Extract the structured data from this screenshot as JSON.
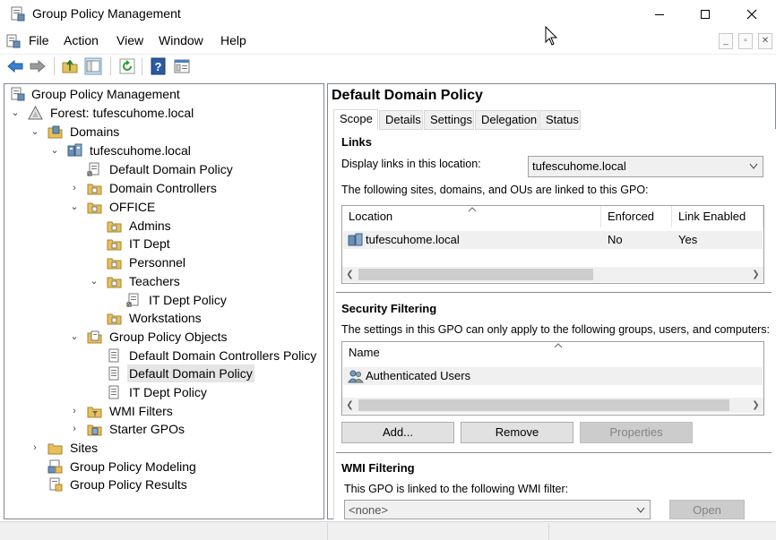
{
  "window": {
    "title": "Group Policy Management"
  },
  "menubar": {
    "items": [
      "File",
      "Action",
      "View",
      "Window",
      "Help"
    ]
  },
  "toolbar": {
    "icons": [
      "back-arrow-icon",
      "forward-arrow-icon",
      "up-folder-icon",
      "show-hide-tree-icon",
      "refresh-icon",
      "help-icon",
      "properties-icon"
    ]
  },
  "tree": {
    "root": "Group Policy Management",
    "forest": "Forest: tufescuhome.local",
    "domains": "Domains",
    "domain": "tufescuhome.local",
    "default_domain_policy_link": "Default Domain Policy",
    "domain_controllers": "Domain Controllers",
    "office": "OFFICE",
    "admins": "Admins",
    "it_dept": "IT Dept",
    "personnel": "Personnel",
    "teachers": "Teachers",
    "it_dept_policy_link": "IT Dept Policy",
    "workstations": "Workstations",
    "gpo_container": "Group Policy Objects",
    "gpo_ddcp": "Default Domain Controllers Policy",
    "gpo_ddp": "Default Domain Policy",
    "gpo_itdp": "IT Dept Policy",
    "wmi_filters": "WMI Filters",
    "starter_gpos": "Starter GPOs",
    "sites": "Sites",
    "modeling": "Group Policy Modeling",
    "results": "Group Policy Results"
  },
  "details": {
    "title": "Default Domain Policy",
    "tabs": [
      "Scope",
      "Details",
      "Settings",
      "Delegation",
      "Status"
    ],
    "links": {
      "header": "Links",
      "display_label": "Display links in this location:",
      "location_value": "tufescuhome.local",
      "linked_text": "The following sites, domains, and OUs are linked to this GPO:",
      "columns": [
        "Location",
        "Enforced",
        "Link Enabled"
      ],
      "rows": [
        {
          "location": "tufescuhome.local",
          "enforced": "No",
          "link_enabled": "Yes"
        }
      ]
    },
    "security": {
      "header": "Security Filtering",
      "desc": "The settings in this GPO can only apply to the following groups, users, and computers:",
      "column": "Name",
      "rows": [
        "Authenticated Users"
      ],
      "buttons": {
        "add": "Add...",
        "remove": "Remove",
        "properties": "Properties"
      }
    },
    "wmi": {
      "header": "WMI Filtering",
      "desc": "This GPO is linked to the following WMI filter:",
      "combo_value": "<none>",
      "open_button": "Open"
    }
  }
}
